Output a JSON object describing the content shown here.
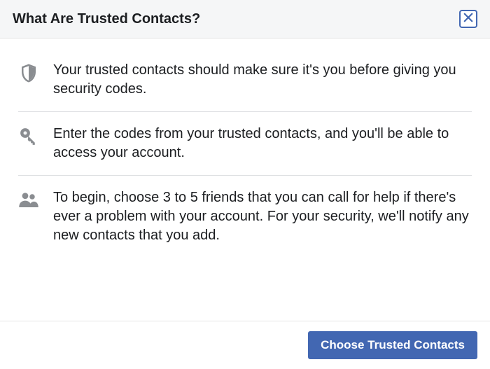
{
  "header": {
    "title": "What Are Trusted Contacts?"
  },
  "rows": [
    {
      "icon": "shield",
      "text": "Your trusted contacts should make sure it's you before giving you security codes."
    },
    {
      "icon": "key",
      "text": "Enter the codes from your trusted contacts, and you'll be able to access your account."
    },
    {
      "icon": "people",
      "text": "To begin, choose 3 to 5 friends that you can call for help if there's ever a problem with your account. For your security, we'll notify any new contacts that you add."
    }
  ],
  "footer": {
    "primary_button": "Choose Trusted Contacts"
  }
}
